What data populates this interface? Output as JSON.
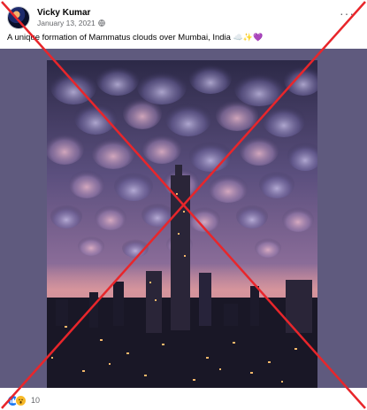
{
  "post": {
    "author": "Vicky Kumar",
    "date": "January 13, 2021",
    "caption_text": "A unique formation of Mammatus clouds over Mumbai, India",
    "caption_emojis": "☁️✨💜",
    "more_label": "···",
    "reaction_count": "10"
  },
  "icons": {
    "avatar": "profile-avatar",
    "privacy": "globe-icon",
    "reactions": [
      "like-icon",
      "wow-icon"
    ]
  },
  "colors": {
    "media_background": "#5f5a7e",
    "overlay_cross": "#e8262b",
    "like": "#1877f2",
    "wow": "#f7b928"
  }
}
